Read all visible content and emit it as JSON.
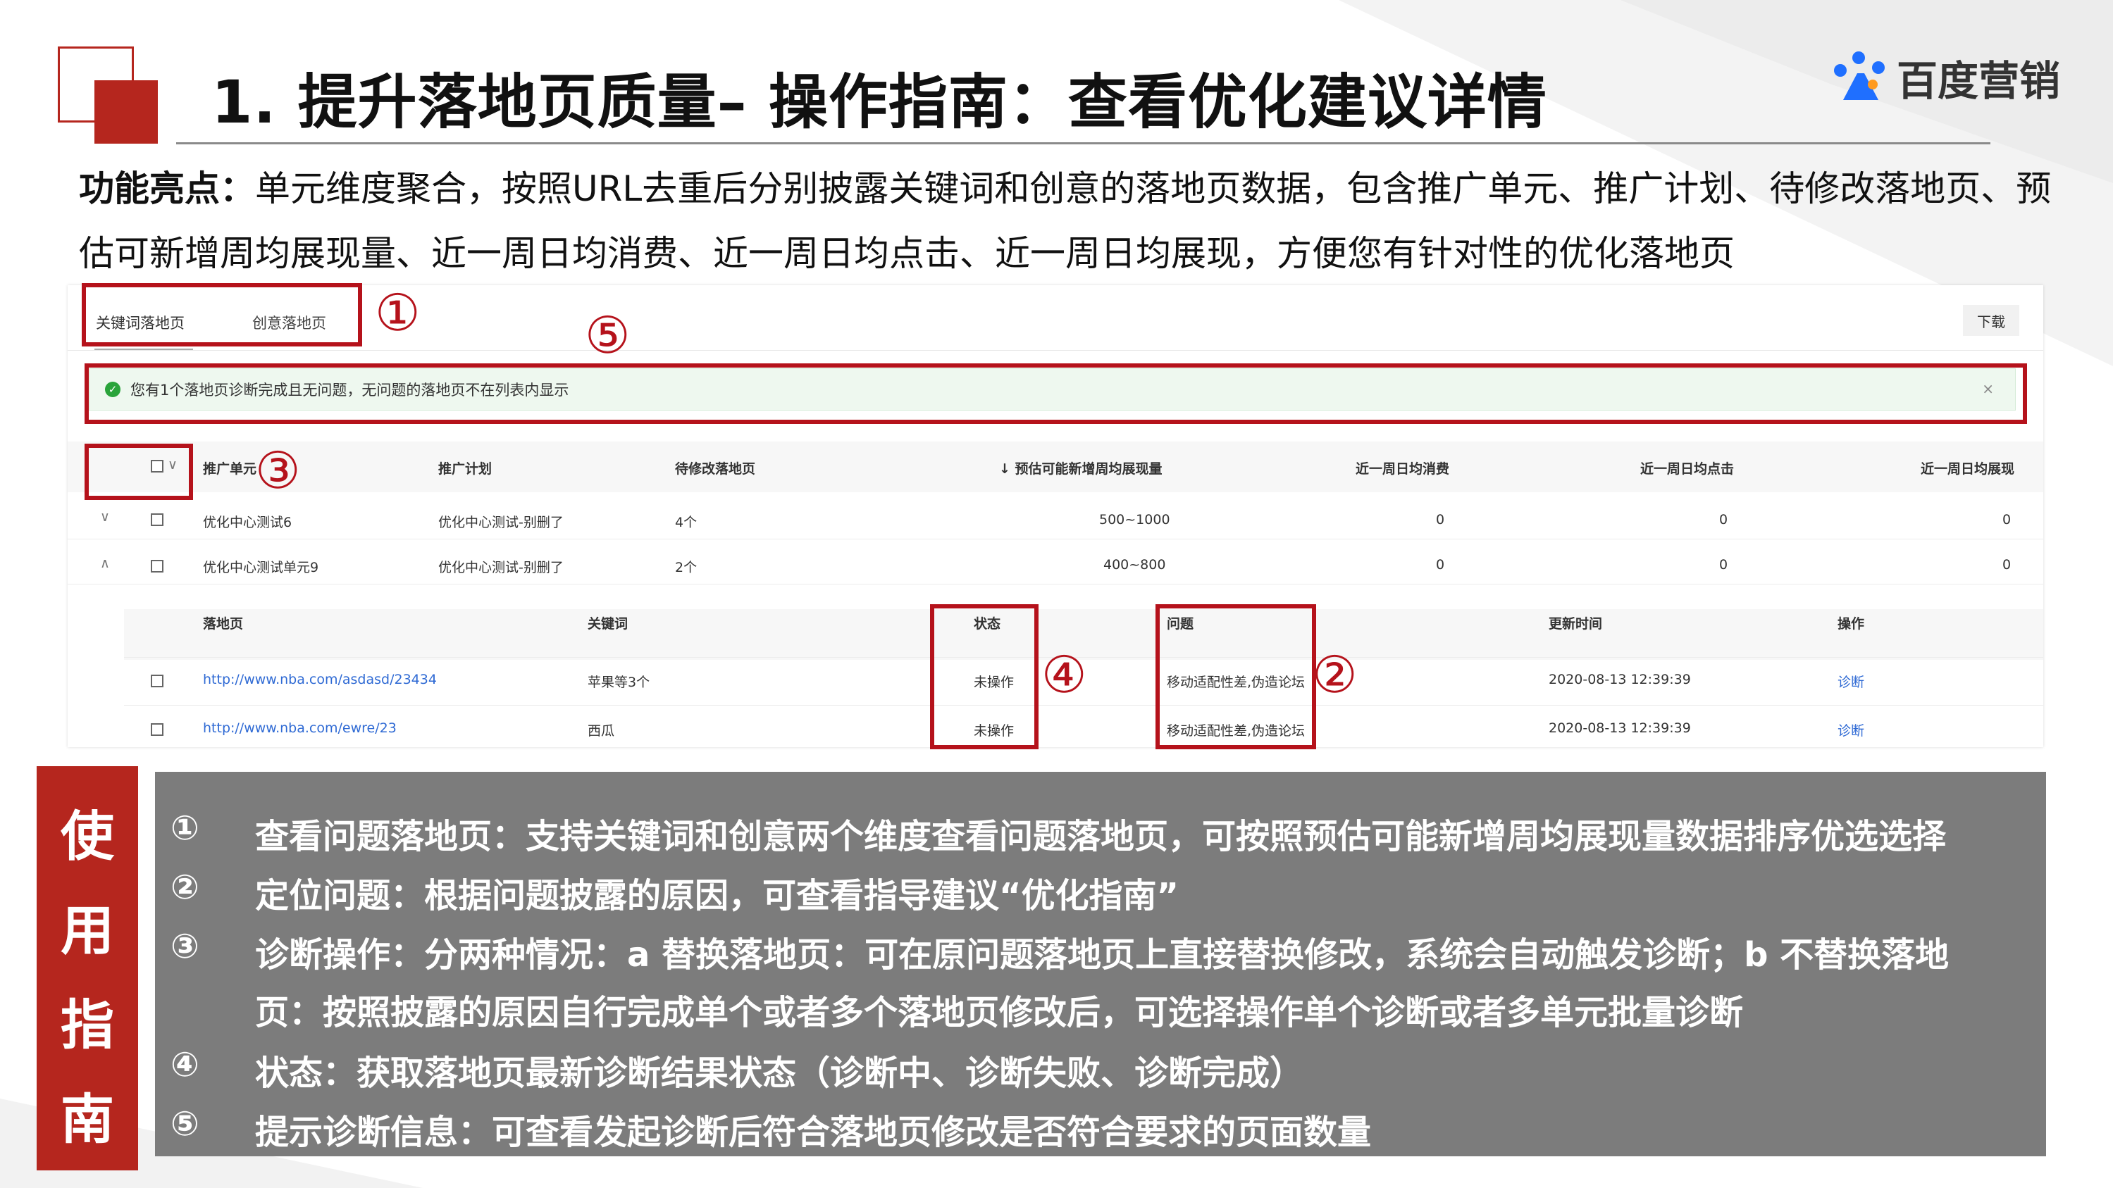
{
  "header": {
    "title": "1. 提升落地页质量– 操作指南：查看优化建议详情",
    "brand_name": "百度营销"
  },
  "description": {
    "label": "功能亮点：",
    "text": "单元维度聚合，按照URL去重后分别披露关键词和创意的落地页数据，包含推广单元、推广计划、待修改落地页、预估可新增周均展现量、近一周日均消费、近一周日均点击、近一周日均展现，方便您有针对性的优化落地页"
  },
  "app": {
    "tabs": [
      "关键词落地页",
      "创意落地页"
    ],
    "download_label": "下载",
    "notice": "您有1个落地页诊断完成且无问题，无问题的落地页不在列表内显示",
    "notice_close": "×",
    "headers": {
      "unit": "推广单元",
      "plan": "推广计划",
      "pages": "待修改落地页",
      "est": "↓ 预估可能新增周均展现量",
      "cost": "近一周日均消费",
      "click": "近一周日均点击",
      "show": "近一周日均展现"
    },
    "rows": [
      {
        "toggle": "∨",
        "unit": "优化中心测试6",
        "plan": "优化中心测试-别删了",
        "pages": "4个",
        "est": "500~1000",
        "cost": "0",
        "click": "0",
        "show": "0"
      },
      {
        "toggle": "∧",
        "unit": "优化中心测试单元9",
        "plan": "优化中心测试-别删了",
        "pages": "2个",
        "est": "400~800",
        "cost": "0",
        "click": "0",
        "show": "0"
      }
    ],
    "sub_headers": {
      "page": "落地页",
      "keyword": "关键词",
      "status": "状态",
      "issue": "问题",
      "time": "更新时间",
      "action": "操作"
    },
    "sub_rows": [
      {
        "page": "http://www.nba.com/asdasd/23434",
        "keyword": "苹果等3个",
        "status": "未操作",
        "issue": "移动适配性差,伪造论坛",
        "time": "2020-08-13 12:39:39",
        "action": "诊断"
      },
      {
        "page": "http://www.nba.com/ewre/23",
        "keyword": "西瓜",
        "status": "未操作",
        "issue": "移动适配性差,伪造论坛",
        "time": "2020-08-13 12:39:39",
        "action": "诊断"
      }
    ]
  },
  "annotations": [
    "①",
    "②",
    "③",
    "④",
    "⑤"
  ],
  "guide": {
    "label_chars": [
      "使",
      "用",
      "指",
      "南"
    ],
    "items": [
      {
        "num": "①",
        "text": "查看问题落地页：支持关键词和创意两个维度查看问题落地页，可按照预估可能新增周均展现量数据排序优选选择"
      },
      {
        "num": "②",
        "text": "定位问题：根据问题披露的原因，可查看指导建议“优化指南”"
      },
      {
        "num": "③",
        "text": "诊断操作：分两种情况：a 替换落地页：可在原问题落地页上直接替换修改，系统会自动触发诊断；b 不替换落地"
      },
      {
        "num": "",
        "text": "页：按照披露的原因自行完成单个或者多个落地页修改后，可选择操作单个诊断或者多单元批量诊断"
      },
      {
        "num": "④",
        "text": "状态：获取落地页最新诊断结果状态（诊断中、诊断失败、诊断完成）"
      },
      {
        "num": "⑤",
        "text": "提示诊断信息：可查看发起诊断后符合落地页修改是否符合要求的页面数量"
      }
    ]
  }
}
